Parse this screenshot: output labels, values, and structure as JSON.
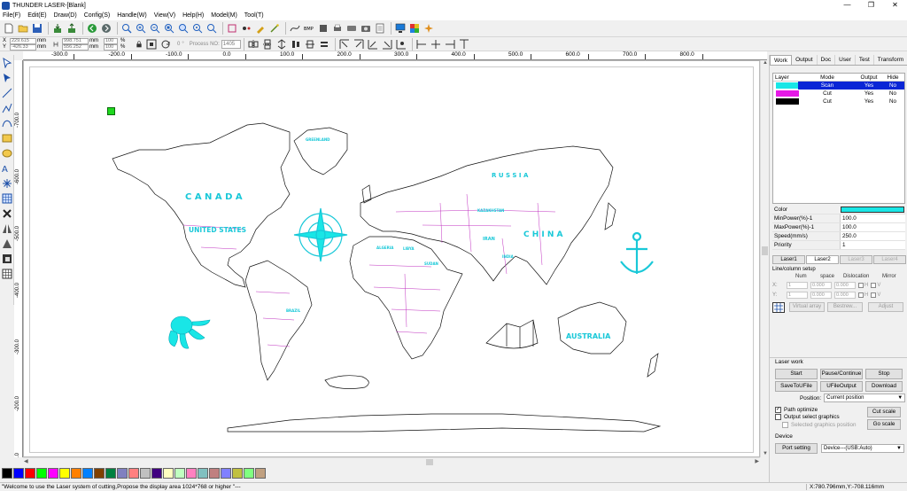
{
  "window": {
    "title": "THUNDER LASER-[Blank]",
    "minimize": "—",
    "maximize": "❐",
    "close": "✕"
  },
  "menu": [
    "File(F)",
    "Edit(E)",
    "Draw(D)",
    "Config(S)",
    "Handle(W)",
    "View(V)",
    "Help(H)",
    "Model(M)",
    "Tool(T)"
  ],
  "toolbar": {
    "x_label": "X",
    "y_label": "Y",
    "x_value": "229.615",
    "y_value": "-426.33",
    "w_value": "998.751",
    "h_value": "556.252",
    "unit": "mm",
    "scale_x": "100",
    "scale_y": "100",
    "percent": "%",
    "rotation": "0",
    "degree": "°",
    "process_label": "Process NO:",
    "process_no": "1405"
  },
  "ruler": {
    "h_ticks": [
      "-300.0",
      "-200.0",
      "-100.0",
      "0.0",
      "100.0",
      "200.0",
      "300.0",
      "400.0",
      "500.0",
      "600.0",
      "700.0",
      "800.0"
    ],
    "v_ticks": [
      "-700.0",
      "-600.0",
      "-500.0",
      "-400.0",
      "-300.0",
      "-200.0",
      "-100.0"
    ]
  },
  "map_labels": {
    "canada": "C A N A D A",
    "united_states": "UNITED STATES",
    "russia": "R U S S I A",
    "china": "C H I N A",
    "australia": "AUSTRALIA",
    "brazil": "BRAZIL",
    "kazakhstan": "KAZAKHSTAN",
    "iran": "IRAN",
    "india": "INDIA",
    "libya": "LIBYA",
    "algeria": "ALGERIA",
    "sudan": "SUDAN",
    "greenland": "GREENLAND"
  },
  "palette": [
    "#000000",
    "#0000ff",
    "#ff0000",
    "#00ff00",
    "#ff00ff",
    "#ffff00",
    "#ff8000",
    "#0080ff",
    "#804000",
    "#008040",
    "#8080c0",
    "#ff8080",
    "#c0c0c0",
    "#400080",
    "#ffffc0",
    "#c0ffc0",
    "#ff80c0",
    "#80c0c0",
    "#c08080",
    "#8080ff",
    "#c0c040",
    "#80ff80",
    "#c0a080"
  ],
  "status": {
    "message": "\"Welcome to use the Laser system of cutting,Propose the display area 1024*768 or higher \"---",
    "coords": "X:780.796mm,Y:-708.116mm"
  },
  "panel": {
    "tabs": [
      "Work",
      "Output",
      "Doc",
      "User",
      "Test",
      "Transform"
    ],
    "layer_headers": [
      "Layer",
      "Mode",
      "Output",
      "Hide"
    ],
    "layers": [
      {
        "color": "#19e6e6",
        "mode": "Scan",
        "output": "Yes",
        "hide": "No"
      },
      {
        "color": "#e619e6",
        "mode": "Cut",
        "output": "Yes",
        "hide": "No"
      },
      {
        "color": "#000000",
        "mode": "Cut",
        "output": "Yes",
        "hide": "No"
      }
    ],
    "props": [
      {
        "key": "Color",
        "value": ""
      },
      {
        "key": "MinPower(%)-1",
        "value": "100.0"
      },
      {
        "key": "MaxPower(%)-1",
        "value": "100.0"
      },
      {
        "key": "Speed(mm/s)",
        "value": "250.0"
      },
      {
        "key": "Priority",
        "value": "1"
      }
    ],
    "laser_tabs": [
      "Laser1",
      "Laser2",
      "Laser3",
      "Laser4"
    ],
    "array": {
      "title": "Line/column setup",
      "head_num": "Num",
      "head_space": "space",
      "head_dislocation": "Dislocation",
      "head_mirror": "Mirror",
      "x_label": "X:",
      "y_label": "Y:",
      "x_num": "1",
      "x_space": "0.000",
      "x_disl": "0.000",
      "y_num": "1",
      "y_space": "0.000",
      "y_disl": "0.000",
      "h": "H",
      "v": "V",
      "virtual_array": "Virtual array",
      "bestrew": "Bestrew...",
      "adjust": "Adjust"
    },
    "laser_work": {
      "title": "Laser work",
      "start": "Start",
      "pause": "Pause/Continue",
      "stop": "Stop",
      "save_to_ufile": "SaveToUFile",
      "ufile_output": "UFileOutput",
      "download": "Download",
      "position_label": "Position:",
      "position_value": "Current position",
      "path_optimize": "Path optimize",
      "output_select": "Output select graphics",
      "output_selected_pos": "Selected graphics position",
      "cut_scale": "Cut scale",
      "go_scale": "Go scale",
      "device_title": "Device",
      "port_setting": "Port setting",
      "device_value": "Device---(USB:Auto)"
    }
  }
}
